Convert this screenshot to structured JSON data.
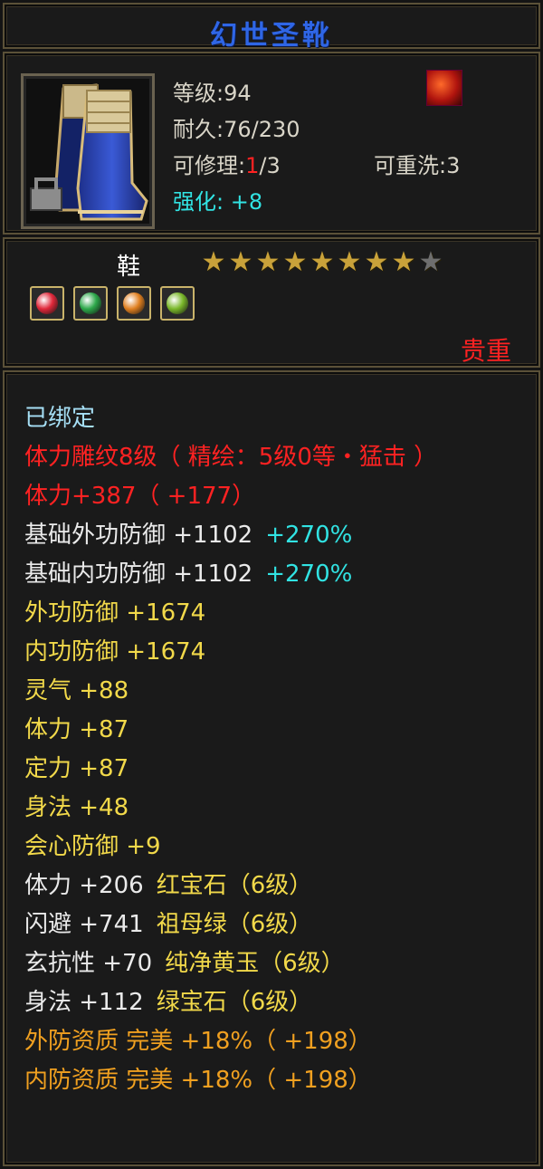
{
  "item": {
    "name": "幻世圣靴",
    "level_label": "等级:",
    "level": "94",
    "durability_label": "耐久:",
    "durability": "76/230",
    "repair_label": "可修理:",
    "repair_used": "1",
    "repair_max": "/3",
    "reroll_label": "可重洗:",
    "reroll": "3",
    "enhance_label": "强化:",
    "enhance": " +8",
    "slot_type": "鞋",
    "stars_filled": 8,
    "stars_total": 9,
    "rarity": "贵重",
    "status_icon": "flame-icon",
    "gems": [
      {
        "name": "red-gem-icon",
        "color": "#e0283a"
      },
      {
        "name": "green-gem-icon",
        "color": "#2da84a"
      },
      {
        "name": "orange-gem-icon",
        "color": "#e08020"
      },
      {
        "name": "jade-gem-icon",
        "color": "#7ab82a"
      }
    ]
  },
  "stats": {
    "bound": "已绑定",
    "carve": "体力雕纹8级（ 精绘：5级0等・猛击 ）",
    "vit_total": "体力+387（ +177）",
    "base_ext_def": "基础外功防御  +1102",
    "base_ext_def_pct": "+270%",
    "base_int_def": "基础内功防御  +1102",
    "base_int_def_pct": "+270%",
    "ext_def": "外功防御  +1674",
    "int_def": "内功防御  +1674",
    "spirit": "灵气  +88",
    "vit": "体力  +87",
    "focus": "定力  +87",
    "agility": "身法  +48",
    "crit_def": "会心防御  +9",
    "gem1_stat": "体力  +206",
    "gem1_name": "红宝石（6级）",
    "gem2_stat": "闪避  +741",
    "gem2_name": "祖母绿（6级）",
    "gem3_stat": "玄抗性  +70",
    "gem3_name": "纯净黄玉（6级）",
    "gem4_stat": "身法  +112",
    "gem4_name": "绿宝石（6级）",
    "q1": "外防资质   完美  +18%（ +198）",
    "q2": "内防资质   完美  +18%（ +198）"
  }
}
